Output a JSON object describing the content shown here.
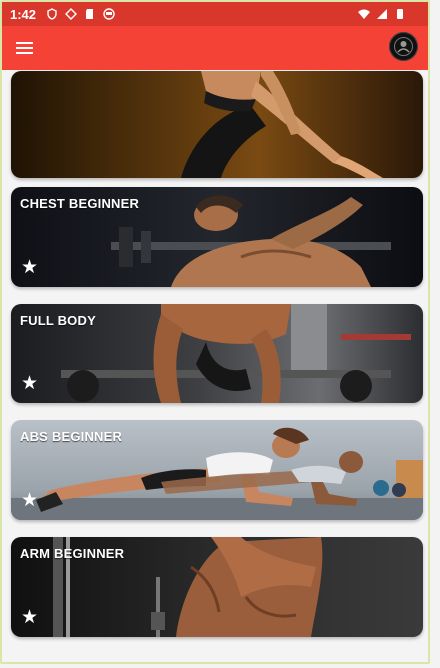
{
  "status_bar": {
    "time": "1:42",
    "left_icons": [
      "shield-icon",
      "download-icon",
      "sd-card-icon",
      "record-icon"
    ],
    "right_icons": [
      "wifi-icon",
      "signal-icon",
      "battery-icon"
    ]
  },
  "toolbar": {
    "menu_icon": "menu-icon",
    "logo_icon": "app-logo-icon",
    "color": "#f44236"
  },
  "workouts": [
    {
      "title": "",
      "favorite_icon": ""
    },
    {
      "title": "CHEST BEGINNER",
      "favorite_icon": "star-icon"
    },
    {
      "title": "FULL BODY",
      "favorite_icon": "star-icon"
    },
    {
      "title": "ABS BEGINNER",
      "favorite_icon": "star-icon"
    },
    {
      "title": "ARM BEGINNER",
      "favorite_icon": "star-icon"
    }
  ]
}
